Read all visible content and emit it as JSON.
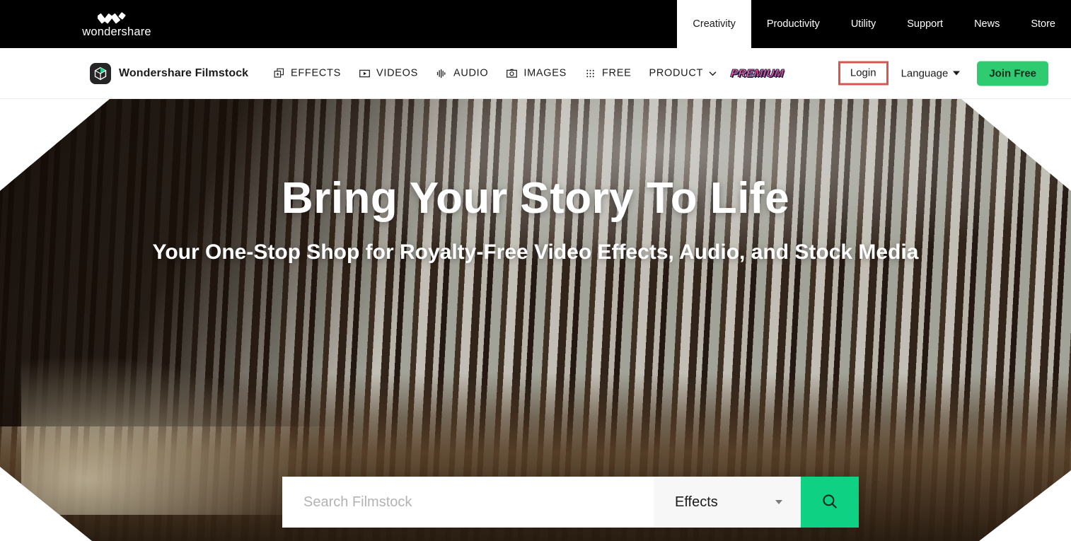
{
  "topbar": {
    "logo": {
      "wordmark": "wondershare",
      "icon": "wondershare-w-mark"
    },
    "nav": [
      {
        "label": "Creativity",
        "active": true
      },
      {
        "label": "Productivity",
        "active": false
      },
      {
        "label": "Utility",
        "active": false
      },
      {
        "label": "Support",
        "active": false
      },
      {
        "label": "News",
        "active": false
      },
      {
        "label": "Store",
        "active": false
      }
    ]
  },
  "subbar": {
    "brand": {
      "name": "Wondershare Filmstock",
      "icon": "filmstock-cube-icon"
    },
    "nav": [
      {
        "label": "EFFECTS",
        "icon": "layers-icon"
      },
      {
        "label": "VIDEOS",
        "icon": "play-rect-icon"
      },
      {
        "label": "AUDIO",
        "icon": "waveform-icon"
      },
      {
        "label": "IMAGES",
        "icon": "camera-icon"
      },
      {
        "label": "FREE",
        "icon": "grid-dots-icon"
      }
    ],
    "product": {
      "label": "PRODUCT",
      "icon": "chevron-down-icon"
    },
    "premium_badge": "PREMIUM",
    "login_label": "Login",
    "language_label": "Language",
    "join_label": "Join Free",
    "colors": {
      "login_highlight": "#d9564f",
      "join_green": "#2ecb71",
      "premium_pink": "#f76b9e"
    }
  },
  "hero": {
    "title": "Bring Your Story To Life",
    "subtitle": "Your One-Stop Shop for Royalty-Free Video Effects, Audio, and Stock Media",
    "background": "forest-trees-video"
  },
  "search": {
    "placeholder": "Search Filmstock",
    "value": "",
    "category_selected": "Effects",
    "submit_icon": "search-icon",
    "accent": "#0fd184"
  }
}
